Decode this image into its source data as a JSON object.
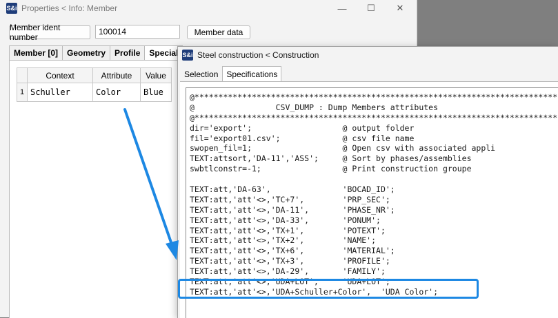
{
  "props_window": {
    "title": "Properties < Info: Member",
    "member_ident_label": "Member ident number",
    "member_ident_value": "100014",
    "member_data_button": "Member data",
    "tabs": [
      {
        "label": "Member [0]",
        "selected": false
      },
      {
        "label": "Geometry",
        "selected": false
      },
      {
        "label": "Profile",
        "selected": false
      },
      {
        "label": "Special",
        "selected": true
      }
    ],
    "table": {
      "headers": [
        "Context",
        "Attribute",
        "Value"
      ],
      "rows": [
        {
          "num": "1",
          "context": "Schuller",
          "attribute": "Color",
          "value": "Blue"
        }
      ]
    }
  },
  "construction_window": {
    "title": "Steel construction < Construction",
    "tabs": [
      {
        "label": "Selection",
        "selected": false
      },
      {
        "label": "Specifications",
        "selected": true
      }
    ],
    "code_lines": [
      "@****************************************************************************",
      "@                 CSV_DUMP : Dump Members attributes",
      "@****************************************************************************",
      "dir='export';                   @ output folder",
      "fil='export01.csv';             @ csv file name",
      "swopen_fil=1;                   @ Open csv with associated appli",
      "TEXT:attsort,'DA-11','ASS';     @ Sort by phases/assemblies",
      "swbtlconstr=-1;                 @ Print construction groupe",
      "",
      "TEXT:att,'DA-63',               'BOCAD_ID';",
      "TEXT:att,'att'<>,'TC+7',        'PRP_SEC';",
      "TEXT:att,'att'<>,'DA-11',       'PHASE_NR';",
      "TEXT:att,'att'<>,'DA-33',       'PONUM';",
      "TEXT:att,'att'<>,'TX+1',        'POTEXT';",
      "TEXT:att,'att'<>,'TX+2',        'NAME';",
      "TEXT:att,'att'<>,'TX+6',        'MATERIAL';",
      "TEXT:att,'att'<>,'TX+3',        'PROFILE';",
      "TEXT:att,'att'<>,'DA-29',       'FAMILY';",
      "TEXT:att,'att'<>,'UDA+LOT',     'UDA+LOT';",
      "TEXT:att,'att'<>,'UDA+Schuller+Color',  'UDA Color';"
    ]
  },
  "colors": {
    "highlight": "#1d88e3",
    "app_icon": "#1f3d7a"
  },
  "icons": {
    "app": "S&i",
    "minimize": "—",
    "maximize": "☐",
    "close": "✕"
  }
}
